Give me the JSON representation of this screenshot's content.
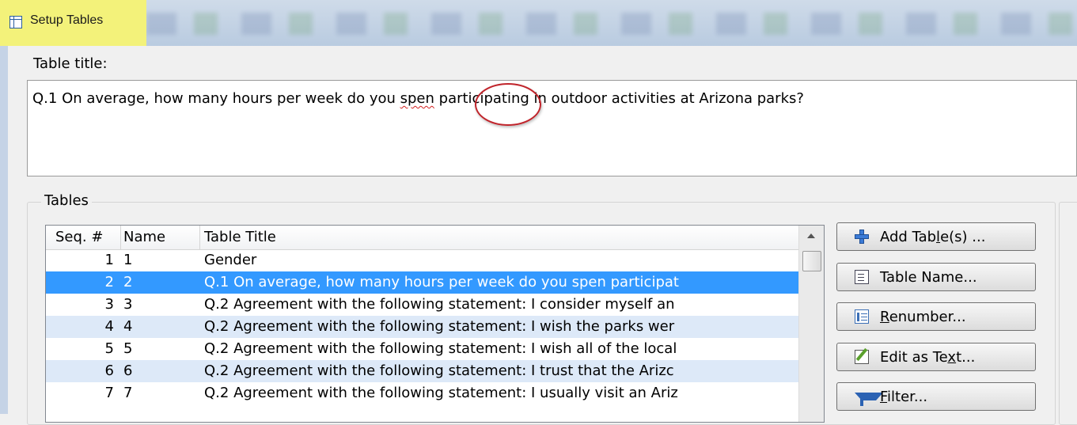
{
  "window": {
    "title": "Setup Tables"
  },
  "title_field": {
    "label": "Table title:",
    "text_before": "Q.1 On average, how many hours per week do you ",
    "misspelled_word": "spen",
    "text_after": " participating in outdoor activities at Arizona parks?"
  },
  "tables_group": {
    "label": "Tables",
    "columns": [
      "Seq. #",
      "Name",
      "Table Title"
    ],
    "rows": [
      {
        "seq": "1",
        "name": "1",
        "title": "Gender"
      },
      {
        "seq": "2",
        "name": "2",
        "title": "Q.1 On average, how many hours per week do you spen participat"
      },
      {
        "seq": "3",
        "name": "3",
        "title": "Q.2 Agreement with the following statement: I consider myself an"
      },
      {
        "seq": "4",
        "name": "4",
        "title": "Q.2 Agreement with the following statement: I wish the parks wer"
      },
      {
        "seq": "5",
        "name": "5",
        "title": "Q.2 Agreement with the following statement: I wish all of the local"
      },
      {
        "seq": "6",
        "name": "6",
        "title": "Q.2 Agreement with the following statement: I trust that the Arizc"
      },
      {
        "seq": "7",
        "name": "7",
        "title": "Q.2 Agreement with the following statement: I usually visit an Ariz"
      }
    ],
    "selected_row_index": 1
  },
  "buttons": {
    "add_tables": {
      "pre": "Add Tab",
      "key": "l",
      "post": "e(s) ..."
    },
    "table_name": {
      "pre": "Table Name...",
      "key": "",
      "post": ""
    },
    "renumber": {
      "pre": "",
      "key": "R",
      "post": "enumber..."
    },
    "edit_as_text": {
      "pre": "Edit as Te",
      "key": "x",
      "post": "t..."
    },
    "filter": {
      "pre": "",
      "key": "F",
      "post": "ilter..."
    }
  },
  "colors": {
    "selection": "#3399ff",
    "alt_row": "#dde9f8",
    "title_highlight": "#f3f27a",
    "annotation_circle": "#c0242b"
  },
  "icons": {
    "window": "table-icon",
    "add": "plus-icon",
    "table_name": "rename-icon",
    "renumber": "numbered-list-icon",
    "edit": "edit-pencil-icon",
    "filter": "funnel-icon"
  }
}
